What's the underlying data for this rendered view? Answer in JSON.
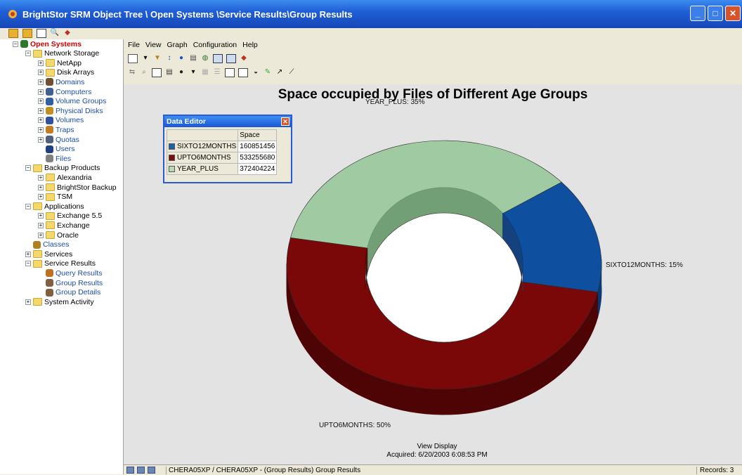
{
  "window": {
    "title": "BrightStor SRM Object Tree \\ Open Systems \\Service Results\\Group Results"
  },
  "tree": [
    {
      "label": "Open Systems",
      "style": "red",
      "level": 0,
      "icon": "open-systems-icon"
    },
    {
      "label": "Network Storage",
      "style": "plain",
      "level": 1,
      "icon": "folder-icon"
    },
    {
      "label": "NetApp",
      "style": "plain",
      "level": 2,
      "icon": "folder-icon"
    },
    {
      "label": "Disk Arrays",
      "style": "plain",
      "level": 2,
      "icon": "folder-icon"
    },
    {
      "label": "Domains",
      "style": "link",
      "level": 2,
      "icon": "domains-icon"
    },
    {
      "label": "Computers",
      "style": "link",
      "level": 2,
      "icon": "computers-icon"
    },
    {
      "label": "Volume Groups",
      "style": "link",
      "level": 2,
      "icon": "volume-groups-icon"
    },
    {
      "label": "Physical Disks",
      "style": "link",
      "level": 2,
      "icon": "physical-disks-icon"
    },
    {
      "label": "Volumes",
      "style": "link",
      "level": 2,
      "icon": "volumes-icon"
    },
    {
      "label": "Traps",
      "style": "link",
      "level": 2,
      "icon": "traps-icon"
    },
    {
      "label": "Quotas",
      "style": "link",
      "level": 2,
      "icon": "quotas-icon"
    },
    {
      "label": "Users",
      "style": "link",
      "level": 2,
      "icon": "users-icon"
    },
    {
      "label": "Files",
      "style": "link",
      "level": 2,
      "icon": "files-icon"
    },
    {
      "label": "Backup Products",
      "style": "plain",
      "level": 1,
      "icon": "folder-icon"
    },
    {
      "label": "Alexandria",
      "style": "plain",
      "level": 2,
      "icon": "folder-icon"
    },
    {
      "label": "BrightStor Backup",
      "style": "plain",
      "level": 2,
      "icon": "folder-icon"
    },
    {
      "label": "TSM",
      "style": "plain",
      "level": 2,
      "icon": "folder-icon"
    },
    {
      "label": "Applications",
      "style": "plain",
      "level": 1,
      "icon": "folder-icon"
    },
    {
      "label": "Exchange 5.5",
      "style": "plain",
      "level": 2,
      "icon": "folder-icon"
    },
    {
      "label": "Exchange",
      "style": "plain",
      "level": 2,
      "icon": "folder-icon"
    },
    {
      "label": "Oracle",
      "style": "plain",
      "level": 2,
      "icon": "folder-icon"
    },
    {
      "label": "Classes",
      "style": "link",
      "level": 1,
      "icon": "classes-icon"
    },
    {
      "label": "Services",
      "style": "plain",
      "level": 1,
      "icon": "folder-icon"
    },
    {
      "label": "Service Results",
      "style": "plain",
      "level": 1,
      "icon": "folder-icon"
    },
    {
      "label": "Query Results",
      "style": "link",
      "level": 2,
      "icon": "query-results-icon"
    },
    {
      "label": "Group Results",
      "style": "link",
      "level": 2,
      "icon": "group-results-icon"
    },
    {
      "label": "Group Details",
      "style": "link",
      "level": 2,
      "icon": "group-details-icon"
    },
    {
      "label": "System Activity",
      "style": "plain",
      "level": 1,
      "icon": "folder-icon"
    }
  ],
  "menu": [
    "File",
    "View",
    "Graph",
    "Configuration",
    "Help"
  ],
  "data_editor": {
    "title": "Data Editor",
    "column": "Space",
    "close": "✕",
    "rows": [
      {
        "name": "SIXTO12MONTHS",
        "value": "160851456",
        "color": "#1f5fa8"
      },
      {
        "name": "UPTO6MONTHS",
        "value": "533255680",
        "color": "#7d0c0c"
      },
      {
        "name": "YEAR_PLUS",
        "value": "372404224",
        "color": "#b7d9b7"
      }
    ]
  },
  "chart_data": {
    "type": "pie",
    "title": "Space occupied by Files of Different Age Groups",
    "slices": [
      {
        "name": "SIXTO12MONTHS",
        "value": 160851456,
        "percent_label": "SIXTO12MONTHS: 15%",
        "color": "#0e4fa0",
        "side": "#0a3a78"
      },
      {
        "name": "UPTO6MONTHS",
        "value": 533255680,
        "percent_label": "UPTO6MONTHS: 50%",
        "color": "#7a0808",
        "side": "#4e0404"
      },
      {
        "name": "YEAR_PLUS",
        "value": 372404224,
        "percent_label": "YEAR_PLUS: 35%",
        "color": "#9fcaa2",
        "side": "#6d9c70"
      }
    ],
    "footer_line1": "View Display",
    "footer_line2": "Acquired: 6/20/2003 6:08:53 PM"
  },
  "status": {
    "main": "CHERA05XP / CHERA05XP - (Group Results) Group Results",
    "right": "Records: 3"
  }
}
